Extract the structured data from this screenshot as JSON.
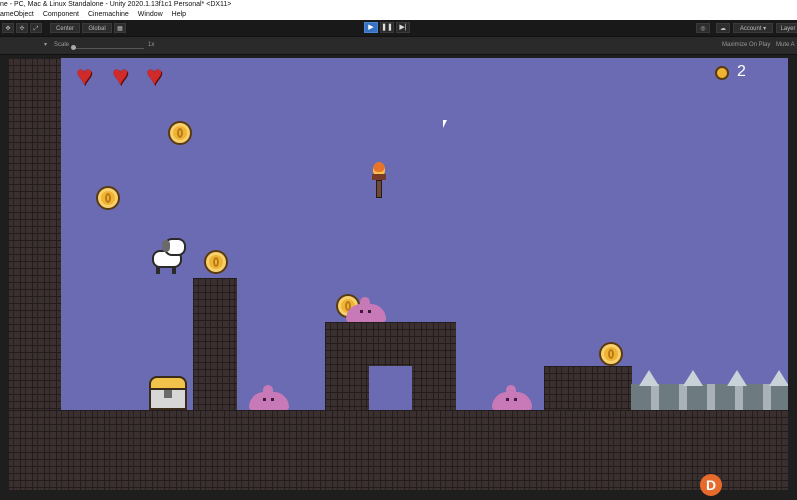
{
  "window": {
    "title": "ne - PC, Mac & Linux Standalone - Unity 2020.1.13f1c1 Personal* <DX11>"
  },
  "menu": [
    "ameObject",
    "Component",
    "Cinemachine",
    "Window",
    "Help"
  ],
  "toolbar": {
    "center_label": "Center",
    "global_label": "Global",
    "account_label": "Account",
    "layers_label": "Layer"
  },
  "game_view": {
    "scale_label": "Scale",
    "scale_value": "1x",
    "maximize_label": "Maximize On Play",
    "mute_label": "Mute A"
  },
  "hud": {
    "lives": 3,
    "coin_count": "2"
  },
  "colors": {
    "sky": "#6b6bb3",
    "brick": "#3a3030",
    "heart": "#d12a2a",
    "coin": "#f0b432",
    "slime": "#c87ab8",
    "play_active": "#3a72c3"
  }
}
